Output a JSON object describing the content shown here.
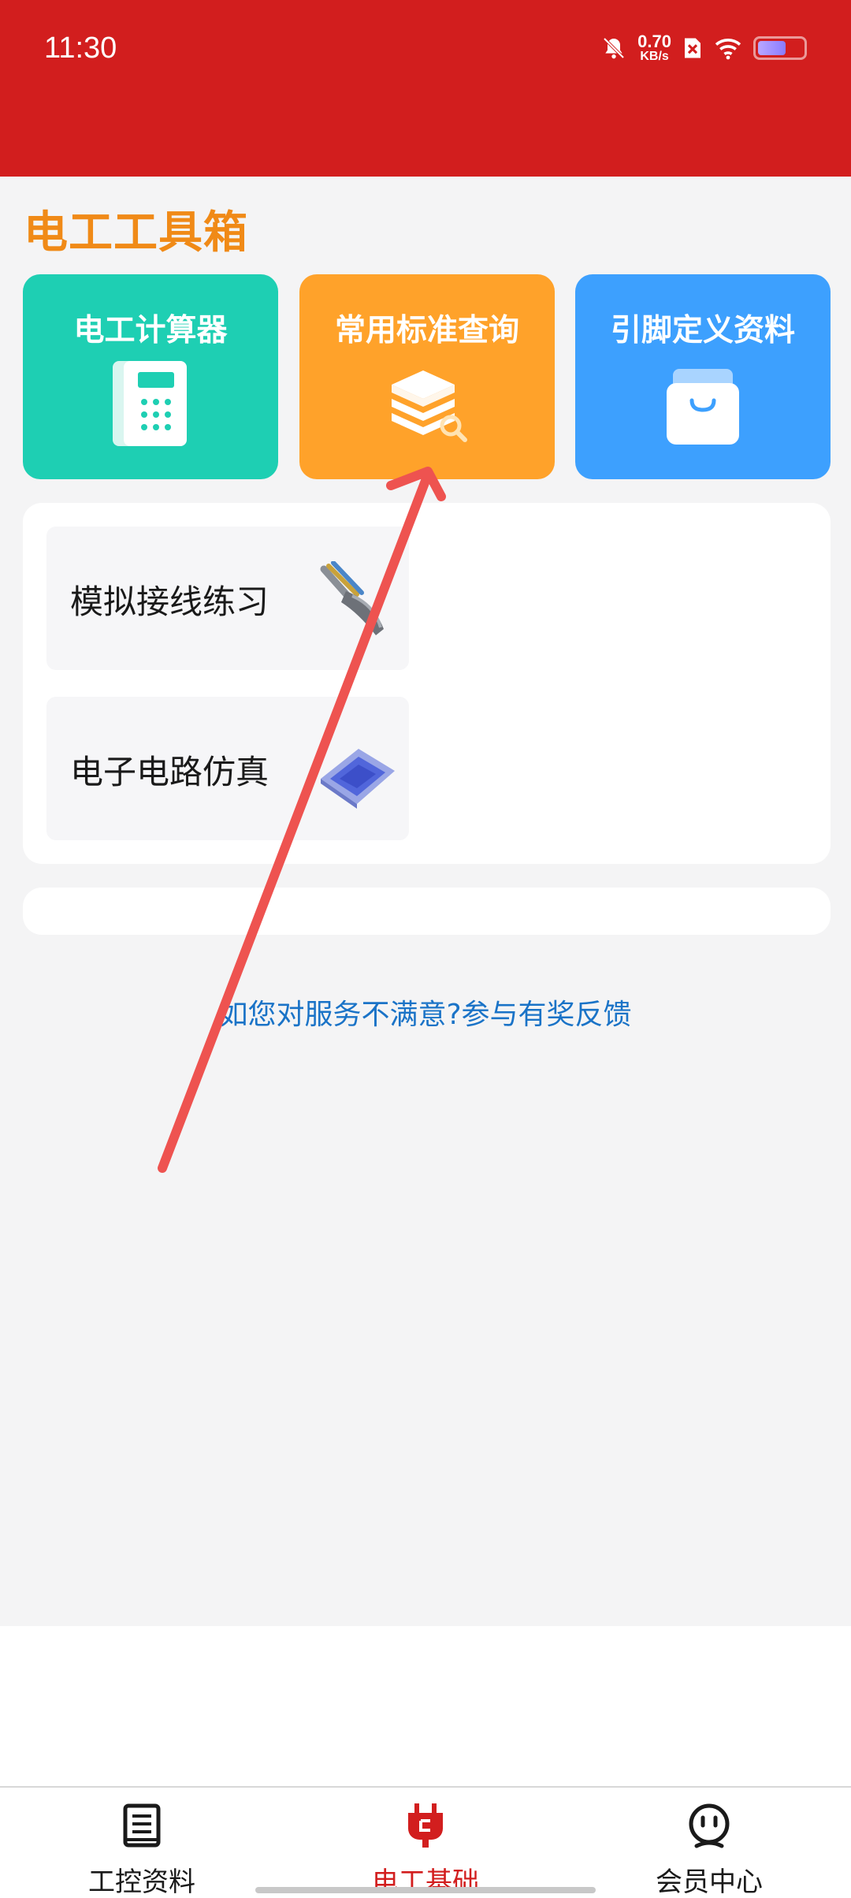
{
  "status_bar": {
    "time": "11:30",
    "net_speed_value": "0.70",
    "net_speed_unit": "KB/s",
    "icons": [
      "bell-off-icon",
      "sim-x-icon",
      "wifi-icon",
      "battery-icon"
    ]
  },
  "colors": {
    "header": "#d21e1e",
    "title": "#f08a17",
    "calc_card": "#1ecfb3",
    "standards_card": "#ffa22a",
    "pin_card": "#3da0fe",
    "link": "#1a73c7",
    "annotation_arrow": "#ee5350"
  },
  "section": {
    "title": "电工工具箱"
  },
  "tools": [
    {
      "label": "电工计算器",
      "icon": "calculator-icon"
    },
    {
      "label": "常用标准查询",
      "icon": "layers-search-icon"
    },
    {
      "label": "引脚定义资料",
      "icon": "archive-box-icon"
    }
  ],
  "practice": [
    {
      "label": "模拟接线练习",
      "image": "cable-wires-image"
    },
    {
      "label": "电子电路仿真",
      "image": "chip-image"
    }
  ],
  "feedback_link": "如您对服务不满意?参与有奖反馈",
  "bottom_nav": [
    {
      "label": "工控资料",
      "icon": "document-icon",
      "active": false
    },
    {
      "label": "电工基础",
      "icon": "plug-icon",
      "active": true
    },
    {
      "label": "会员中心",
      "icon": "smiley-icon",
      "active": false
    }
  ]
}
